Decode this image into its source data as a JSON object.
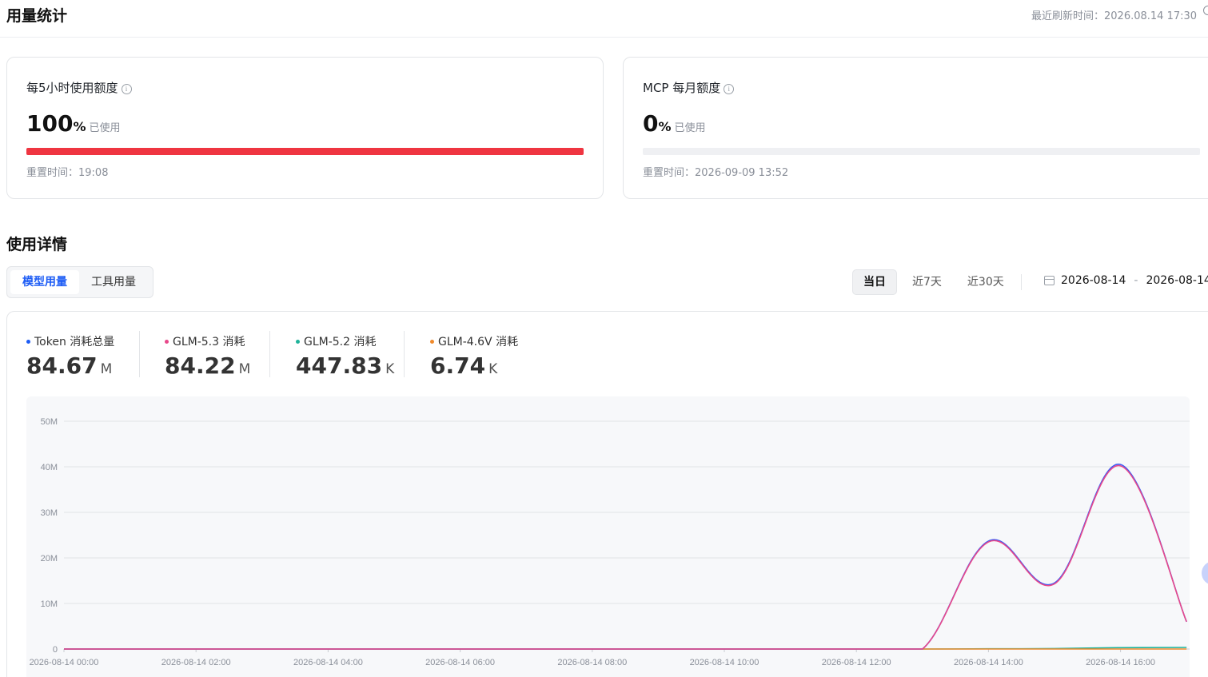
{
  "header": {
    "title": "用量统计",
    "refresh_time": "最近刷新时间：2026.08.14 17:30"
  },
  "quota": [
    {
      "title": "每5小时使用额度",
      "value": "100",
      "unit": "%",
      "used_label": "已使用",
      "reset": "重置时间：19:08",
      "fraction": 1.0,
      "bar_color": "#ef3541"
    },
    {
      "title": "MCP 每月额度",
      "value": "0",
      "unit": "%",
      "used_label": "已使用",
      "reset": "重置时间：2026-09-09 13:52",
      "fraction": 0.0,
      "bar_color": "#ef3541"
    }
  ],
  "details": {
    "title": "使用详情",
    "tabs": [
      "模型用量",
      "工具用量"
    ],
    "active_tab": 0,
    "ranges": [
      "当日",
      "近7天",
      "近30天"
    ],
    "active_range": 0,
    "date_start": "2026-08-14",
    "date_sep": "-",
    "date_end": "2026-08-14"
  },
  "stats": [
    {
      "label": "Token 消耗总量",
      "value": "84.67",
      "unit": "M",
      "color": "#1d5cf5"
    },
    {
      "label": "GLM-5.3 消耗",
      "value": "84.22",
      "unit": "M",
      "color": "#e8488a"
    },
    {
      "label": "GLM-5.2 消耗",
      "value": "447.83",
      "unit": "K",
      "color": "#1fb39a"
    },
    {
      "label": "GLM-4.6V 消耗",
      "value": "6.74",
      "unit": "K",
      "color": "#f08a2c"
    }
  ],
  "chart_data": {
    "type": "line",
    "x_labels": [
      "2026-08-14 00:00",
      "2026-08-14 02:00",
      "2026-08-14 04:00",
      "2026-08-14 06:00",
      "2026-08-14 08:00",
      "2026-08-14 10:00",
      "2026-08-14 12:00",
      "2026-08-14 14:00",
      "2026-08-14 16:00"
    ],
    "y_ticks": [
      "0",
      "10M",
      "20M",
      "30M",
      "40M",
      "50M"
    ],
    "ylim": [
      0,
      50
    ],
    "x_hours": [
      0,
      1,
      2,
      3,
      4,
      5,
      6,
      7,
      8,
      9,
      10,
      11,
      12,
      13,
      14,
      15,
      16,
      17
    ],
    "series": [
      {
        "name": "Token 消耗总量",
        "color": "#3b5bf5",
        "values": [
          0,
          0,
          0,
          0,
          0,
          0,
          0,
          0,
          0,
          0,
          0,
          0,
          0,
          0,
          23.7,
          14.5,
          40.5,
          6.0
        ]
      },
      {
        "name": "GLM-5.3 消耗",
        "color": "#e8488a",
        "values": [
          0,
          0,
          0,
          0,
          0,
          0,
          0,
          0,
          0,
          0,
          0,
          0,
          0,
          0,
          23.5,
          14.3,
          40.2,
          6.0
        ]
      },
      {
        "name": "GLM-5.2 消耗",
        "color": "#1fb39a",
        "values": [
          0,
          0,
          0,
          0,
          0,
          0,
          0,
          0,
          0,
          0,
          0,
          0,
          0,
          0,
          0.05,
          0.1,
          0.3,
          0.35
        ]
      },
      {
        "name": "GLM-4.6V 消耗",
        "color": "#f08a2c",
        "values": [
          0,
          0,
          0,
          0,
          0,
          0,
          0,
          0,
          0,
          0,
          0,
          0,
          0,
          0,
          0,
          0,
          0,
          0
        ]
      }
    ],
    "grid": true
  }
}
